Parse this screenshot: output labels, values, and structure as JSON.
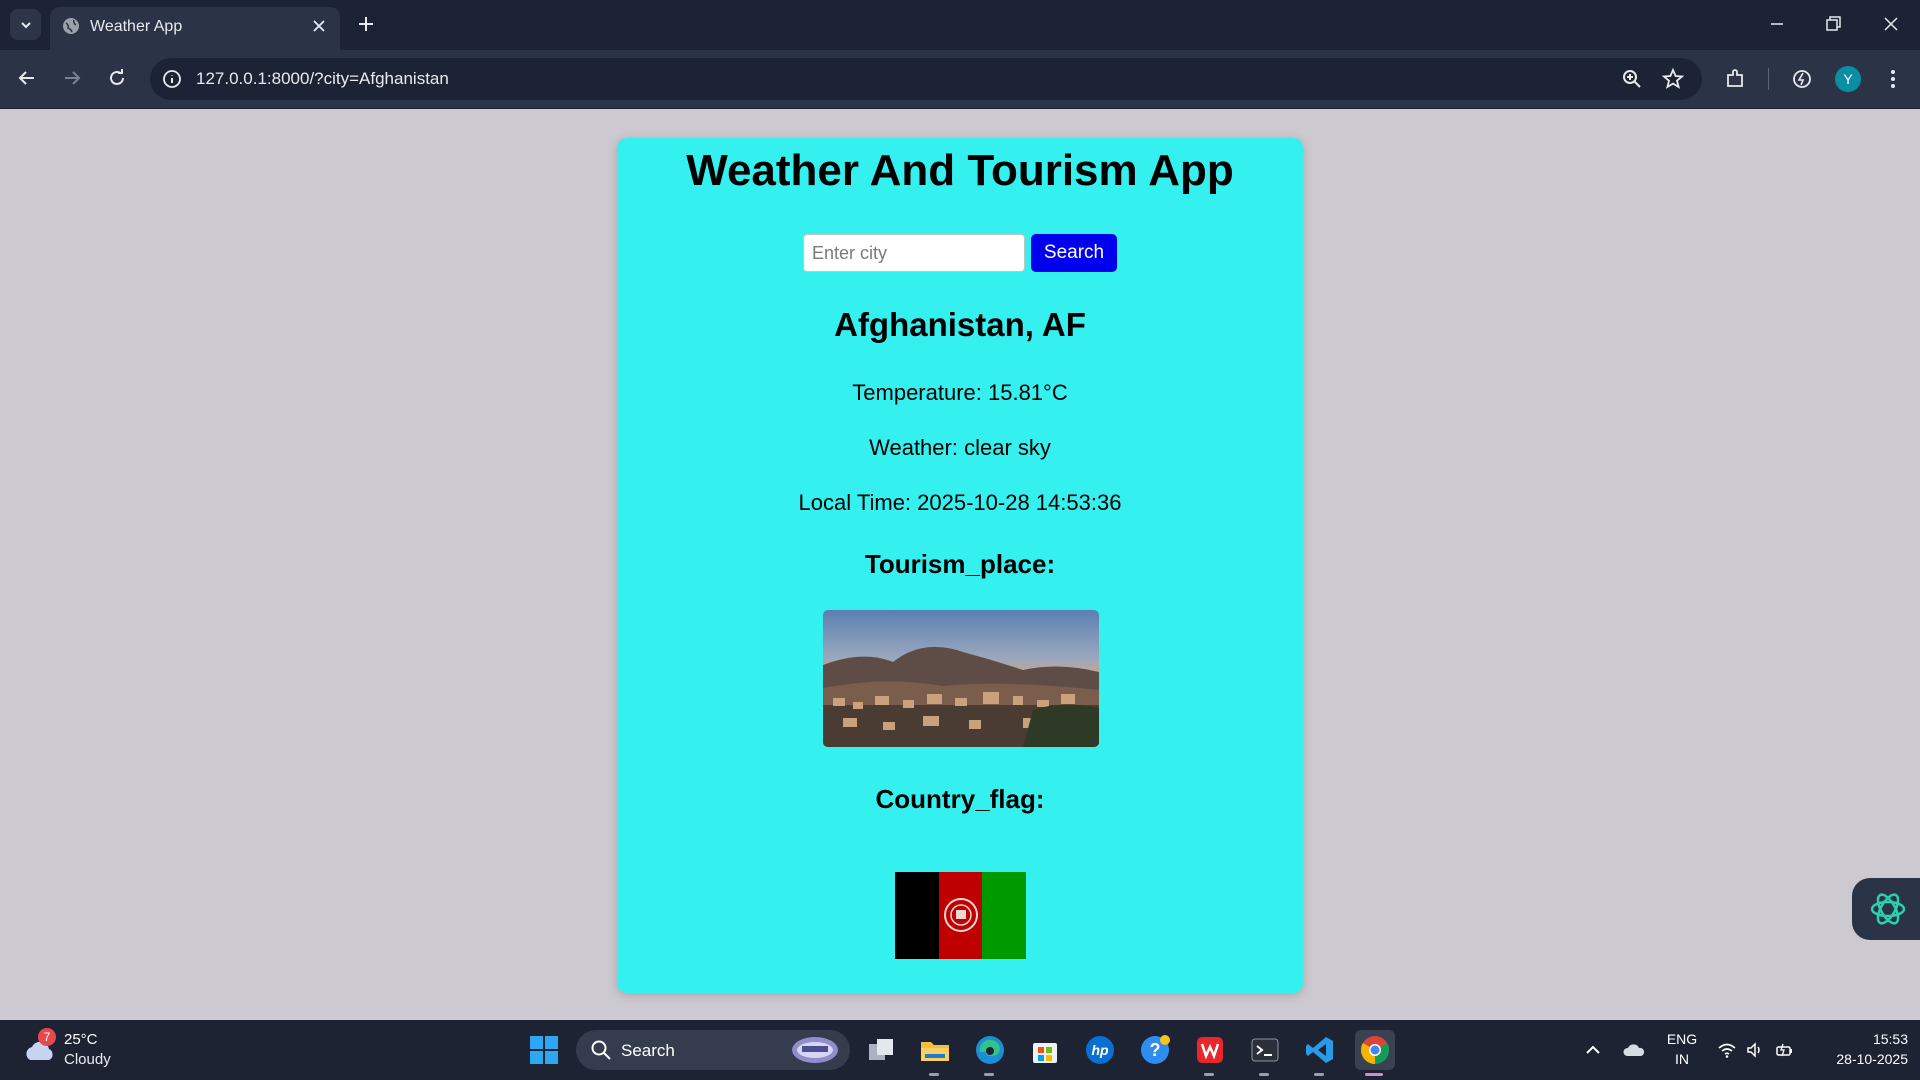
{
  "browser": {
    "tab_title": "Weather App",
    "url": "127.0.0.1:8000/?city=Afghanistan",
    "profile_initial": "Y"
  },
  "app": {
    "title": "Weather And Tourism App",
    "search": {
      "placeholder": "Enter city",
      "value": "",
      "button_label": "Search"
    },
    "city_heading": "Afghanistan, AF",
    "temperature_line": "Temperature: 15.81°C",
    "weather_line": "Weather: clear sky",
    "local_time_line": "Local Time: 2025-10-28 14:53:36",
    "tourism_heading": "Tourism_place:",
    "flag_heading": "Country_flag:",
    "colors": {
      "card_background": "#34f1f0",
      "search_button": "#0000ee",
      "page_background": "#cdc9d1"
    },
    "flag_colors": [
      "#000000",
      "#bf0000",
      "#009900"
    ]
  },
  "taskbar": {
    "weather_badge": "7",
    "temperature": "25°C",
    "condition": "Cloudy",
    "search_label": "Search",
    "apps": [
      "windows-start-icon",
      "search-icon",
      "task-view-icon",
      "file-explorer-icon",
      "edge-icon",
      "microsoft-store-icon",
      "hp-icon",
      "help-icon",
      "wps-office-icon",
      "terminal-icon",
      "vscode-icon",
      "chrome-icon"
    ],
    "language_top": "ENG",
    "language_bottom": "IN",
    "time": "15:53",
    "date": "28-10-2025"
  }
}
